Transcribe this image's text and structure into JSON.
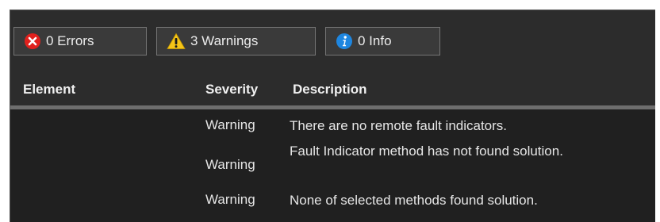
{
  "filters": {
    "errors": {
      "label": "0 Errors",
      "icon": "error-icon",
      "color": "#e0211d"
    },
    "warnings": {
      "label": "3 Warnings",
      "icon": "warning-icon",
      "color": "#f5c518"
    },
    "info": {
      "label": "0 Info",
      "icon": "info-icon",
      "color": "#1e86e0"
    }
  },
  "table": {
    "columns": [
      "Element",
      "Severity",
      "Description"
    ],
    "rows": [
      {
        "element": "",
        "severity": "Warning",
        "description": "There are no remote fault indicators."
      },
      {
        "element": "",
        "severity": "Warning",
        "description": "Fault Indicator method has not found solution."
      },
      {
        "element": "",
        "severity": "Warning",
        "description": "None of selected methods found solution."
      }
    ]
  }
}
